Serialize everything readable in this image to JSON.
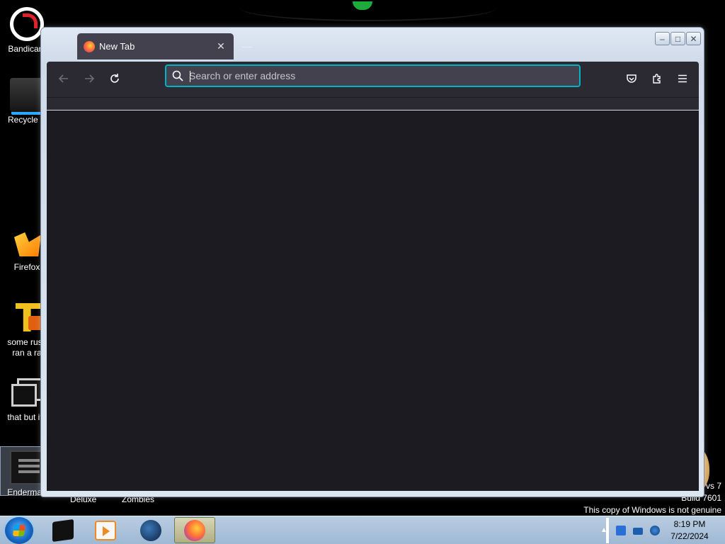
{
  "desktop": {
    "icons": [
      {
        "label": "Bandicam"
      },
      {
        "label": "Recycle B"
      },
      {
        "label": "Firefox"
      },
      {
        "label": "some russ\nran a ra"
      },
      {
        "label": "that but its"
      },
      {
        "label": "Enderman"
      }
    ],
    "captions": [
      "Deluxe",
      "Zombies"
    ],
    "watermark": {
      "line1": "vs 7",
      "line2": "Build 7601",
      "line3": "This copy of Windows is not genuine"
    }
  },
  "browser": {
    "tab": {
      "title": "New Tab"
    },
    "urlbar": {
      "placeholder": "Search or enter address",
      "value": ""
    },
    "new_tab_symbol": "—",
    "window_controls": {
      "minimize": "–",
      "maximize": "□",
      "close": "✕"
    },
    "accent_color": "#00b3c2"
  },
  "taskbar": {
    "clock": {
      "time": "8:19 PM",
      "date": "7/22/2024"
    }
  }
}
